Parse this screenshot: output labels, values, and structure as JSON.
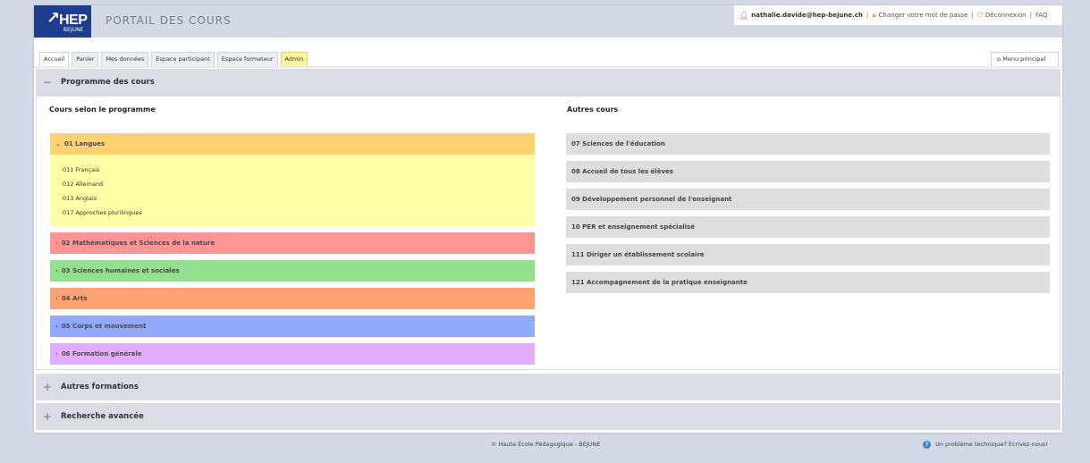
{
  "logo": {
    "text": "HEP",
    "sub": "BEJUNE"
  },
  "header": {
    "title": "PORTAIL DES COURS"
  },
  "userbar": {
    "email": "nathalie.davide@hep-bejune.ch",
    "change_password": "Changer votre mot de passe",
    "logout": "Déconnexion",
    "faq": "FAQ",
    "separator": "|"
  },
  "tabs": [
    {
      "label": "Accueil"
    },
    {
      "label": "Panier"
    },
    {
      "label": "Mes données"
    },
    {
      "label": "Espace participant"
    },
    {
      "label": "Espace formateur"
    },
    {
      "label": "Admin"
    }
  ],
  "menu_principal": "Menu principal",
  "sections": {
    "programme": {
      "title": "Programme des cours",
      "toggle": "−"
    },
    "autres_formations": {
      "title": "Autres formations",
      "toggle": "+"
    },
    "recherche": {
      "title": "Recherche avancée",
      "toggle": "+"
    }
  },
  "programme": {
    "left_title": "Cours selon le programme",
    "right_title": "Autres cours",
    "items": [
      {
        "label": "01 Langues",
        "color": "#ffd271",
        "expanded": true,
        "chevron": "⌄"
      },
      {
        "label": "02 Mathématiques et Sciences de la nature",
        "color": "#ff9494",
        "chevron": "›"
      },
      {
        "label": "03 Sciences humaines et sociales",
        "color": "#93e08e",
        "chevron": "›"
      },
      {
        "label": "04 Arts",
        "color": "#ffa271",
        "chevron": "›"
      },
      {
        "label": "05 Corps et mouvement",
        "color": "#93a8ff",
        "chevron": "›"
      },
      {
        "label": "06 Formation générale",
        "color": "#e2acff",
        "chevron": "›"
      }
    ],
    "subitems": [
      {
        "label": "011 Français"
      },
      {
        "label": "012 Allemand"
      },
      {
        "label": "013 Anglais"
      },
      {
        "label": "017 Approches plurilingues"
      }
    ],
    "sublist_color": "#ffffa8",
    "other_courses": [
      {
        "label": "07 Sciences de l'éducation"
      },
      {
        "label": "08 Accueil de tous les élèves"
      },
      {
        "label": "09 Développement personnel de l'enseignant"
      },
      {
        "label": "10 PER et enseignement spécialisé"
      },
      {
        "label": "111 Diriger un établissement scolaire"
      },
      {
        "label": "121 Accompagnement de la pratique enseignante"
      }
    ]
  },
  "footer": {
    "copyright": "© Haute École Pédagogique - BEJUNE",
    "help": "Un problème technique? Ecrivez-nous!"
  },
  "colors": {
    "brand": "#1d3d8f",
    "admin_tab": "#fff4a0",
    "help": "#2e86de"
  }
}
